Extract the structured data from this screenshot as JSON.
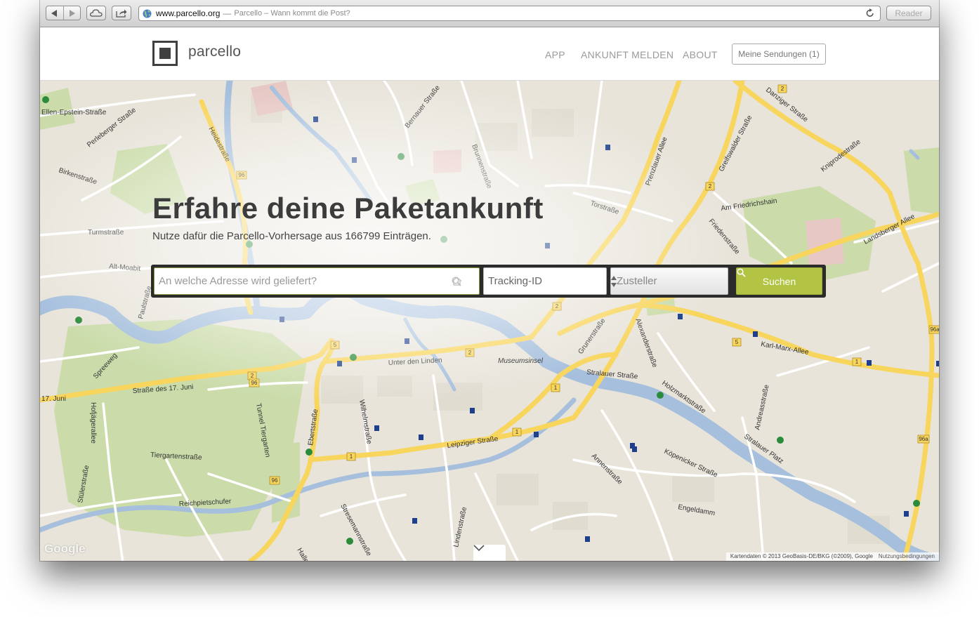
{
  "browser": {
    "url": "www.parcello.org",
    "separator": "—",
    "page_title": "Parcello – Wann kommt die Post?",
    "reader_label": "Reader"
  },
  "site": {
    "logo_text": "parcello",
    "nav": [
      "APP",
      "ANKUNFT MELDEN",
      "ABOUT"
    ],
    "shipments_button": "Meine Sendungen (1)"
  },
  "hero": {
    "title": "Erfahre deine Paketankunft",
    "subtitle": "Nutze dafür die Parcello-Vorhersage aus 166799 Einträgen."
  },
  "search": {
    "address_placeholder": "An welche Adresse wird geliefert?",
    "tracking_placeholder": "Tracking-ID",
    "carrier_value": "Zusteller",
    "submit_label": "Suchen"
  },
  "map": {
    "street_labels": [
      "Ellen-Epstein-Straße",
      "Perleberger Straße",
      "Heidestraße",
      "Birkenstraße",
      "Turmstraße",
      "Alt-Moabit",
      "Paulstraße",
      "Spreeweg",
      "Straße des 17. Juni",
      "17. Juni",
      "Hofjägerallee",
      "Stülerstraße",
      "Tiergartenstraße",
      "Reichpietschufer",
      "Tunnel Tiergarten",
      "Ebertstraße",
      "Wilhelmstraße",
      "Stresemannstraße",
      "Unter den Linden",
      "Leipziger Straße",
      "Lindenstraße",
      "Bernauer Straße",
      "Brunnenstraße",
      "Torstraße",
      "Prenzlauer Allee",
      "Greifswalder Straße",
      "Danziger Straße",
      "Kniprodestraße",
      "Am Friedrichshain",
      "Friedenstraße",
      "Landsberger Allee",
      "Grunerstraße",
      "Alexanderstraße",
      "Karl-Marx-Allee",
      "Stralauer Straße",
      "Holzmarktstraße",
      "Andreasstraße",
      "Köpenicker Straße",
      "Annenstraße",
      "Engeldamm",
      "Stralauer Platz",
      "Halle"
    ],
    "poi_label": "Museumsinsel",
    "road_numbers": [
      "96",
      "2",
      "5",
      "1",
      "96a"
    ],
    "google_logo": "Google",
    "attribution": "Kartendaten © 2013 GeoBasis-DE/BKG (©2009), Google",
    "terms": "Nutzungsbedingungen"
  },
  "colors": {
    "accent": "#b3c444",
    "map_background": "#e8e4da",
    "water": "#a5bfdd",
    "park": "#cbdcaa",
    "major_road": "#f8d55c"
  },
  "icons": [
    "back-icon",
    "forward-icon",
    "cloud-icon",
    "share-icon",
    "globe-icon",
    "reload-icon",
    "home-icon",
    "search-icon",
    "select-arrows-icon",
    "chevron-down-icon"
  ]
}
